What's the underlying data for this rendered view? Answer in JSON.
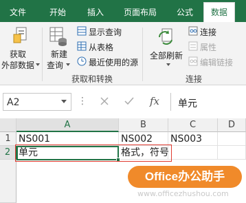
{
  "tabs": [
    {
      "label": "文件",
      "active": false
    },
    {
      "label": "开始",
      "active": false
    },
    {
      "label": "插入",
      "active": false
    },
    {
      "label": "页面布局",
      "active": false
    },
    {
      "label": "公式",
      "active": false
    },
    {
      "label": "数据",
      "active": true
    }
  ],
  "ribbon": {
    "get_external_data": [
      "获取",
      "外部数据"
    ],
    "new_query": [
      "新建",
      "查询"
    ],
    "show_queries": "显示查询",
    "from_table": "从表格",
    "recent_sources": "最近使用的源",
    "group_get_transform": "获取和转换",
    "refresh_all": "全部刷新",
    "connections": "连接",
    "properties": "属性",
    "edit_links": "编辑链接",
    "group_connections": "连接"
  },
  "formula_bar": {
    "name_box": "A2",
    "fx": "fx",
    "formula": "单元"
  },
  "sheet": {
    "columns": [
      "A",
      "B",
      "C",
      "D"
    ],
    "rows": [
      "1",
      "2"
    ],
    "cells": {
      "A1": "NS001",
      "B1": "NS002",
      "C1": "NS003",
      "A2": "单元",
      "B2": "格式，符号"
    }
  },
  "watermark": {
    "brand": "Office办公助手",
    "site": "www.officezhushou.com"
  },
  "colors": {
    "accent": "#217346",
    "highlight": "#e03a2f",
    "watermark": "#f08a2a"
  }
}
